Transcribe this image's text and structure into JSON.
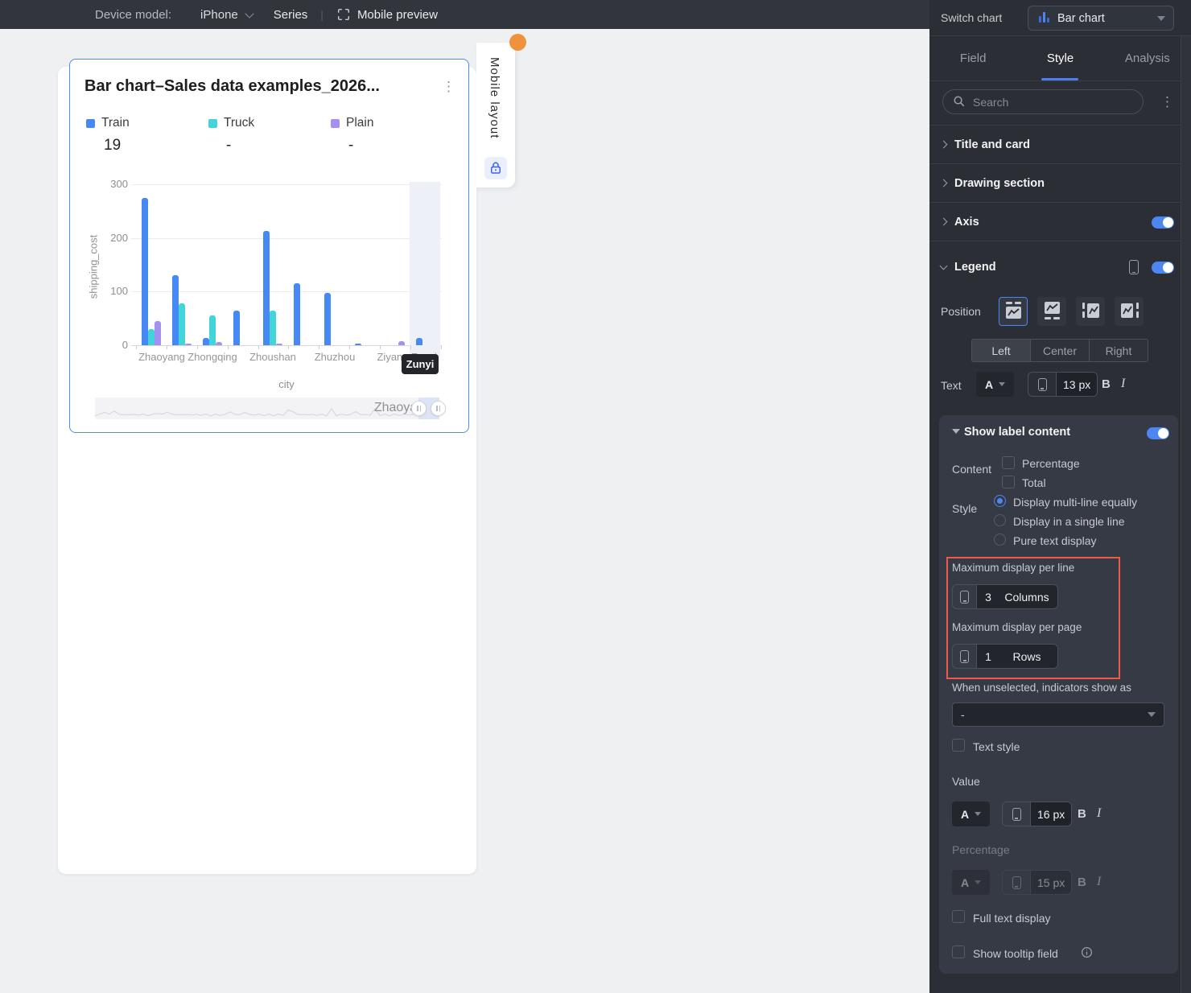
{
  "colors": {
    "accent_blue": "#4c86f0",
    "card_border_blue": "#4a8cf5",
    "highlight_red": "#ee5a4c",
    "orange_dot": "#f0913c",
    "train": "#4688f4",
    "truck": "#41d5da",
    "plain": "#a68ff2"
  },
  "topbar": {
    "device_model_label": "Device model:",
    "device_value": "iPhone",
    "series_label": "Series",
    "mobile_preview_label": "Mobile preview"
  },
  "preview": {
    "mobile_layout_tab": "Mobile layout",
    "card": {
      "title": "Bar chart–Sales data examples_2026...",
      "legend": [
        {
          "name": "Train",
          "value": "19",
          "color": "#4688f4"
        },
        {
          "name": "Truck",
          "value": "-",
          "color": "#41d5da"
        },
        {
          "name": "Plain",
          "value": "-",
          "color": "#a68ff2"
        }
      ],
      "tooltip": "Zunyi",
      "scrollbar_label": "Zhaoyang"
    }
  },
  "chart_data": {
    "type": "bar",
    "title": "Bar chart–Sales data examples_2026...",
    "xlabel": "city",
    "ylabel": "shipping_cost",
    "ylim": [
      0,
      300
    ],
    "yticks": [
      0,
      100,
      200,
      300
    ],
    "grid": true,
    "legend_position": "top",
    "x_tick_labels": [
      "Zhaoyang",
      "Zhongqing",
      "Zhoushan",
      "Zhuzhou",
      "Ziyang",
      "Zunyi"
    ],
    "highlighted_category": "Zunyi",
    "series": [
      {
        "name": "Train",
        "color": "#4688f4",
        "summary_value": "19",
        "values": [
          275,
          130,
          13,
          65,
          213,
          115,
          97,
          3,
          null,
          13
        ]
      },
      {
        "name": "Truck",
        "color": "#41d5da",
        "summary_value": "-",
        "values": [
          30,
          78,
          55,
          null,
          65,
          null,
          null,
          null,
          null,
          null
        ]
      },
      {
        "name": "Plain",
        "color": "#a68ff2",
        "summary_value": "-",
        "values": [
          45,
          3,
          6,
          null,
          3,
          null,
          null,
          null,
          8,
          null
        ]
      }
    ]
  },
  "panel": {
    "switch_chart_label": "Switch chart",
    "chart_type": "Bar chart",
    "tabs": [
      {
        "label": "Field",
        "active": false
      },
      {
        "label": "Style",
        "active": true
      },
      {
        "label": "Analysis",
        "active": false
      }
    ],
    "search_placeholder": "Search",
    "sections": [
      {
        "label": "Title and card",
        "expanded": false,
        "toggle": false,
        "phone_icon": false
      },
      {
        "label": "Drawing section",
        "expanded": false,
        "toggle": false,
        "phone_icon": false
      },
      {
        "label": "Axis",
        "expanded": false,
        "toggle": true,
        "phone_icon": false
      },
      {
        "label": "Legend",
        "expanded": true,
        "toggle": true,
        "phone_icon": true
      }
    ],
    "legend_section": {
      "position_label": "Position",
      "position_options": [
        "top",
        "bottom",
        "left",
        "right"
      ],
      "position_selected": "top",
      "alignment_options": [
        "Left",
        "Center",
        "Right"
      ],
      "alignment_selected": "Left",
      "text_label": "Text",
      "color_button": "A",
      "text_size": "13 px",
      "bold_label": "B",
      "italic_label": "I",
      "show_label_content": {
        "title": "Show label content",
        "toggle_on": true,
        "content_label": "Content",
        "content_options": [
          {
            "label": "Percentage",
            "checked": false
          },
          {
            "label": "Total",
            "checked": false
          }
        ],
        "style_label": "Style",
        "style_options": [
          {
            "label": "Display multi-line equally",
            "selected": true
          },
          {
            "label": "Display in a single line",
            "selected": false
          },
          {
            "label": "Pure text display",
            "selected": false
          }
        ],
        "max_per_line_label": "Maximum display per line",
        "max_per_line_value": "3",
        "max_per_line_unit": "Columns",
        "max_per_page_label": "Maximum display per page",
        "max_per_page_value": "1",
        "max_per_page_unit": "Rows",
        "unselected_label": "When unselected, indicators show as",
        "unselected_value": "-",
        "text_style_label": "Text style",
        "value_label": "Value",
        "value_size": "16 px",
        "percentage_label": "Percentage",
        "percentage_size": "15 px",
        "full_text_label": "Full text display",
        "tooltip_field_label": "Show tooltip field"
      }
    }
  }
}
